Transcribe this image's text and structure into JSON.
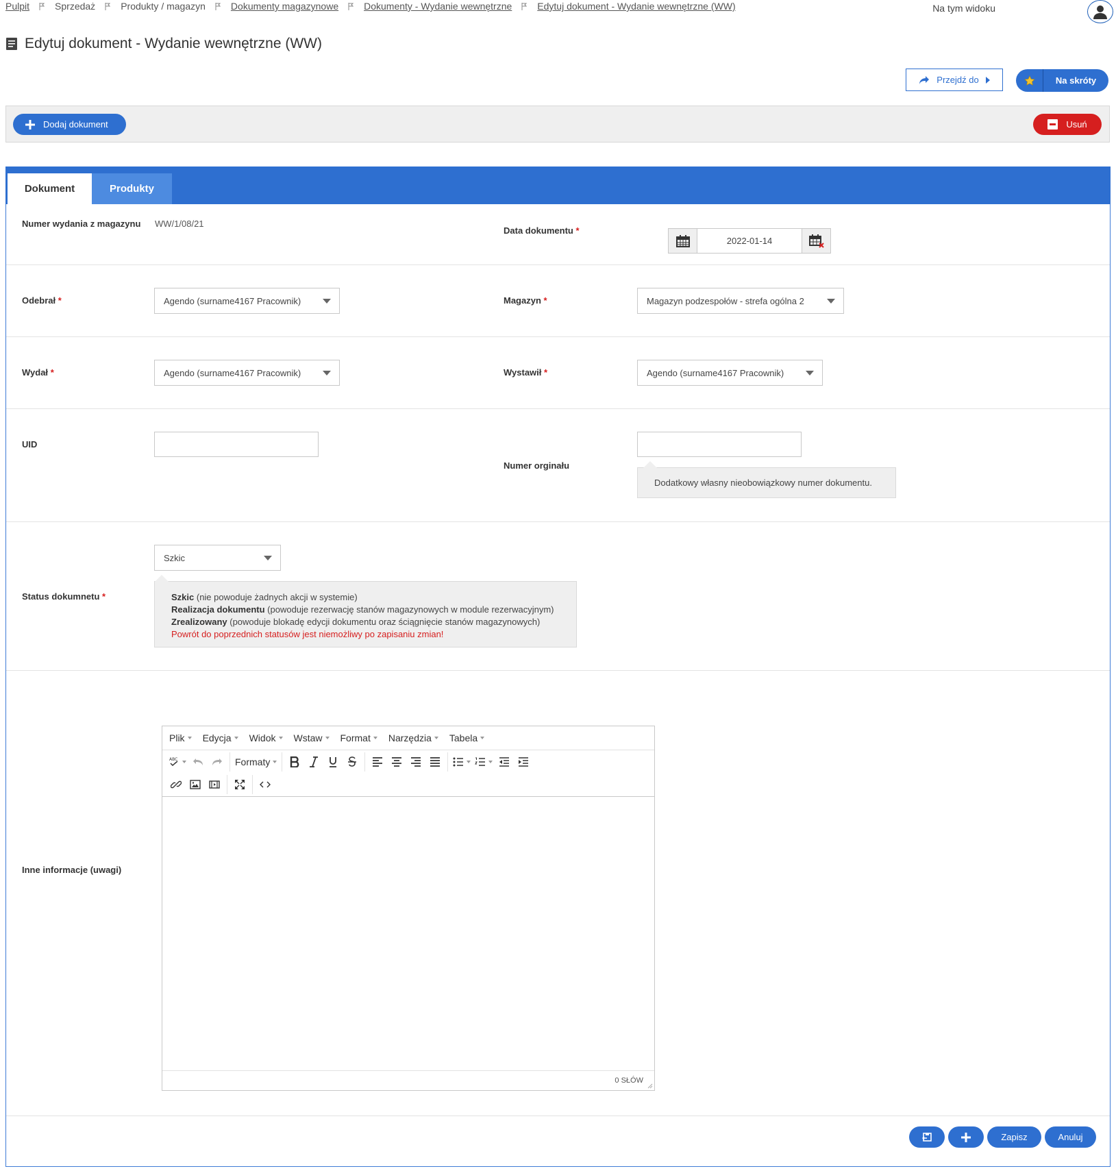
{
  "breadcrumb": {
    "items": [
      {
        "label": "Pulpit"
      },
      {
        "label": "Sprzedaż"
      },
      {
        "label": "Produkty / magazyn"
      },
      {
        "label": "Dokumenty magazynowe"
      },
      {
        "label": "Dokumenty - Wydanie wewnętrzne"
      },
      {
        "label": "Edytuj dokument - Wydanie wewnętrzne (WW)"
      }
    ]
  },
  "header": {
    "view_link": "Na tym widoku",
    "title": "Edytuj dokument - Wydanie wewnętrzne (WW)",
    "goto_label": "Przejdź do",
    "shortcuts_label": "Na skróty"
  },
  "toolbar": {
    "add_label": "Dodaj dokument",
    "delete_label": "Usuń"
  },
  "tabs": [
    {
      "label": "Dokument",
      "active": true
    },
    {
      "label": "Produkty",
      "active": false
    }
  ],
  "form": {
    "number_label": "Numer wydania z magazynu",
    "number_value": "WW/1/08/21",
    "date_label": "Data dokumentu",
    "date_value": "2022-01-14",
    "received_label": "Odebrał",
    "received_value": "Agendo (surname4167 Pracownik)",
    "warehouse_label": "Magazyn",
    "warehouse_value": "Magazyn podzespołów - strefa ogólna 2",
    "issued_label": "Wydał",
    "issued_value": "Agendo (surname4167 Pracownik)",
    "issuer_label": "Wystawił",
    "issuer_value": "Agendo (surname4167 Pracownik)",
    "uid_label": "UID",
    "uid_value": "",
    "original_label": "Numer orginału",
    "original_value": "",
    "original_hint": "Dodatkowy własny nieobowiązkowy numer dokumentu.",
    "status_label": "Status dokumnetu",
    "status_value": "Szkic",
    "status_hint": {
      "draft_term": "Szkic",
      "draft_desc": " (nie powoduje żadnych akcji w systemie)",
      "realization_term": "Realizacja dokumentu",
      "realization_desc": " (powoduje rezerwację stanów magazynowych w module rezerwacyjnym)",
      "done_term": "Zrealizowany",
      "done_desc": " (powoduje blokadę edycji dokumentu oraz ściągnięcie stanów magazynowych)",
      "warning": "Powrót do poprzednich statusów jest niemożliwy po zapisaniu zmian!"
    },
    "notes_label": "Inne informacje (uwagi)",
    "required_mark": "*"
  },
  "editor": {
    "menu": [
      "Plik",
      "Edycja",
      "Widok",
      "Wstaw",
      "Format",
      "Narzędzia",
      "Tabela"
    ],
    "formats_label": "Formaty",
    "word_count": "0 SŁÓW"
  },
  "footer": {
    "save_label": "Zapisz",
    "cancel_label": "Anuluj"
  },
  "colors": {
    "accent": "#2e6fd0",
    "danger": "#d61f1f",
    "tab_inactive": "#4d8be0",
    "bar_bg": "#efefef"
  }
}
